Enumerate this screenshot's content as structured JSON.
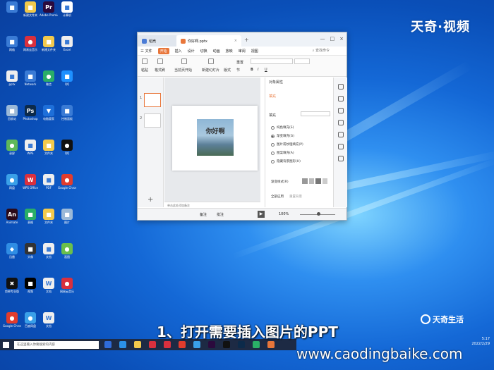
{
  "watermark": "天奇·视频",
  "caption": "1、打开需要插入图片的PPT",
  "url": "www.caodingbaike.com",
  "brand2": "天奇生活",
  "clock": {
    "time": "5:17",
    "date": "2022/2/29"
  },
  "desktop_icons": [
    {
      "label": "­",
      "color": "#3a7bd5",
      "glyph": "■"
    },
    {
      "label": "新建文件夹",
      "color": "#f2c94c",
      "glyph": "■"
    },
    {
      "label": "Adobe\nPremiere",
      "color": "#2b0a3d",
      "glyph": "Pr"
    },
    {
      "label": "计算机",
      "color": "#ffffff",
      "glyph": "■"
    },
    {
      "label": "网络",
      "color": "#3a7bd5",
      "glyph": "■"
    },
    {
      "label": "网易云音乐",
      "color": "#d9303e",
      "glyph": "●"
    },
    {
      "label": "新建文件夹",
      "color": "#f2c94c",
      "glyph": "■"
    },
    {
      "label": "Excel",
      "color": "#eeeeee",
      "glyph": "■"
    },
    {
      "label": "pptx",
      "color": "#eeeeee",
      "glyph": "■"
    },
    {
      "label": "Network",
      "color": "#3a7bd5",
      "glyph": "■"
    },
    {
      "label": "微信",
      "color": "#2aae67",
      "glyph": "●"
    },
    {
      "label": "QQ",
      "color": "#1e90ff",
      "glyph": "■"
    },
    {
      "label": "回收站",
      "color": "#9bb9d8",
      "glyph": "■"
    },
    {
      "label": "Photoshop",
      "color": "#0c2a4a",
      "glyph": "Ps"
    },
    {
      "label": "电脑管家",
      "color": "#1e6fd9",
      "glyph": "▼"
    },
    {
      "label": "控制面板",
      "color": "#3a7bd5",
      "glyph": "■"
    },
    {
      "label": "录屏",
      "color": "#5fb85a",
      "glyph": "●"
    },
    {
      "label": "WPS",
      "color": "#eeeeee",
      "glyph": "■"
    },
    {
      "label": "文件夹",
      "color": "#f2c94c",
      "glyph": "■"
    },
    {
      "label": "QQ",
      "color": "#111111",
      "glyph": "●"
    },
    {
      "label": "网盘",
      "color": "#3aa0e8",
      "glyph": "●"
    },
    {
      "label": "WPS Office",
      "color": "#d9303e",
      "glyph": "W"
    },
    {
      "label": "PDF",
      "color": "#eeeeee",
      "glyph": "■"
    },
    {
      "label": "Google\nChrome",
      "color": "#e23c2d",
      "glyph": "●"
    },
    {
      "label": "Animate",
      "color": "#2b0a1a",
      "glyph": "An"
    },
    {
      "label": "表格",
      "color": "#2aae67",
      "glyph": "■"
    },
    {
      "label": "文件夹",
      "color": "#f2c94c",
      "glyph": "■"
    },
    {
      "label": "图片",
      "color": "#9bb9d8",
      "glyph": "■"
    },
    {
      "label": "迅雷",
      "color": "#2f8de4",
      "glyph": "◆"
    },
    {
      "label": "头像",
      "color": "#333333",
      "glyph": "■"
    },
    {
      "label": "文档",
      "color": "#eeeeee",
      "glyph": "■"
    },
    {
      "label": "画图",
      "color": "#6abf4b",
      "glyph": "●"
    },
    {
      "label": "剪映专业版",
      "color": "#111111",
      "glyph": "✖"
    },
    {
      "label": "视频",
      "color": "#000000",
      "glyph": "■"
    },
    {
      "label": "文档",
      "color": "#eeeeee",
      "glyph": "W"
    },
    {
      "label": "网易云音乐",
      "color": "#d9303e",
      "glyph": "●"
    },
    {
      "label": "Google Chrome",
      "color": "#e23c2d",
      "glyph": "●"
    },
    {
      "label": "百度网盘",
      "color": "#3aa0e8",
      "glyph": "●"
    },
    {
      "label": "文档",
      "color": "#eeeeee",
      "glyph": "W"
    }
  ],
  "wps": {
    "tabs": [
      "稻壳",
      "你好啊.pptx"
    ],
    "menu": [
      "三 文件",
      "开始",
      "插入",
      "设计",
      "切换",
      "动画",
      "放映",
      "审阅",
      "视图"
    ],
    "active_menu": "开始",
    "search": "查找命令",
    "ribbon": [
      "粘贴",
      "格式刷",
      "当前页开始",
      "新建幻灯片",
      "版式",
      "重置",
      "节"
    ],
    "slide_text": "你好啊",
    "notes_placeholder": "单击此处添加备注",
    "panel_title": "对象属性",
    "panel_tab": "填充",
    "fill_header": "填充",
    "fill_options": [
      "纯色填充(S)",
      "渐变填充(G)",
      "图片或纹理填充(P)",
      "图案填充(A)",
      "隐藏背景图形(H)"
    ],
    "selected_option": 1,
    "gradient_label": "渐变样式(R)",
    "apply_all": "全部应用",
    "reset_bg": "重置背景",
    "zoom": "100%",
    "status_notes": "备注",
    "status_comment": "批注",
    "thumbs": [
      "1",
      "2"
    ]
  },
  "taskbar": {
    "search_placeholder": "在这里输入你要搜索的内容"
  }
}
